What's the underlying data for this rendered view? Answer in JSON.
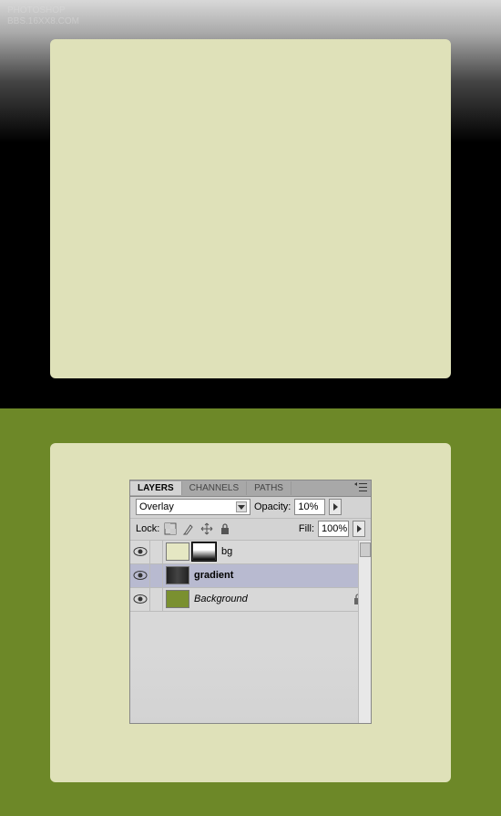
{
  "tabs": {
    "layers": "LAYERS",
    "channels": "CHANNELS",
    "paths": "PATHS"
  },
  "blend": {
    "mode": "Overlay",
    "opacity_label": "Opacity:",
    "opacity_value": "10%",
    "fill_label": "Fill:",
    "fill_value": "100%"
  },
  "lock": {
    "label": "Lock:"
  },
  "layers": [
    {
      "name": "bg",
      "selected": false,
      "has_mask": true,
      "thumb": "bg",
      "bold": false,
      "italic": false,
      "locked": false
    },
    {
      "name": "gradient",
      "selected": true,
      "has_mask": false,
      "thumb": "grad",
      "bold": true,
      "italic": false,
      "locked": false
    },
    {
      "name": "Background",
      "selected": false,
      "has_mask": false,
      "thumb": "green",
      "bold": false,
      "italic": true,
      "locked": true
    }
  ]
}
